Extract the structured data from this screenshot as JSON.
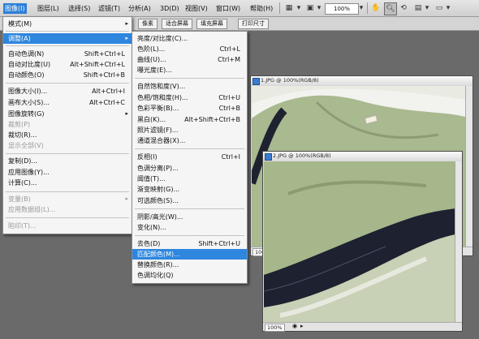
{
  "menubar": {
    "items": [
      "图像(I)",
      "图层(L)",
      "选择(S)",
      "滤镜(T)",
      "分析(A)",
      "3D(D)",
      "视图(V)",
      "窗口(W)",
      "帮助(H)"
    ],
    "zoom": "100%"
  },
  "options_bar": {
    "buttons": [
      "像素",
      "适合屏幕",
      "填充屏幕",
      "打印尺寸"
    ]
  },
  "image_menu": {
    "items": [
      {
        "label": "模式(M)",
        "shortcut": ""
      },
      {
        "label": "调整(A)",
        "shortcut": ""
      },
      {
        "label": "自动色调(N)",
        "shortcut": "Shift+Ctrl+L"
      },
      {
        "label": "自动对比度(U)",
        "shortcut": "Alt+Shift+Ctrl+L"
      },
      {
        "label": "自动颜色(O)",
        "shortcut": "Shift+Ctrl+B"
      },
      {
        "label": "图像大小(I)...",
        "shortcut": "Alt+Ctrl+I"
      },
      {
        "label": "画布大小(S)...",
        "shortcut": "Alt+Ctrl+C"
      },
      {
        "label": "图像旋转(G)",
        "shortcut": ""
      },
      {
        "label": "裁剪(P)",
        "shortcut": ""
      },
      {
        "label": "裁切(R)...",
        "shortcut": ""
      },
      {
        "label": "显示全部(V)",
        "shortcut": ""
      },
      {
        "label": "复制(D)...",
        "shortcut": ""
      },
      {
        "label": "应用图像(Y)...",
        "shortcut": ""
      },
      {
        "label": "计算(C)...",
        "shortcut": ""
      },
      {
        "label": "变量(B)",
        "shortcut": ""
      },
      {
        "label": "应用数据组(L)...",
        "shortcut": ""
      },
      {
        "label": "陷印(T)...",
        "shortcut": ""
      }
    ]
  },
  "adjust_menu": {
    "items": [
      {
        "label": "亮度/对比度(C)...",
        "shortcut": ""
      },
      {
        "label": "色阶(L)...",
        "shortcut": "Ctrl+L"
      },
      {
        "label": "曲线(U)...",
        "shortcut": "Ctrl+M"
      },
      {
        "label": "曝光度(E)...",
        "shortcut": ""
      },
      {
        "label": "自然饱和度(V)...",
        "shortcut": ""
      },
      {
        "label": "色相/饱和度(H)...",
        "shortcut": "Ctrl+U"
      },
      {
        "label": "色彩平衡(B)...",
        "shortcut": "Ctrl+B"
      },
      {
        "label": "黑白(K)...",
        "shortcut": "Alt+Shift+Ctrl+B"
      },
      {
        "label": "照片滤镜(F)...",
        "shortcut": ""
      },
      {
        "label": "通道混合器(X)...",
        "shortcut": ""
      },
      {
        "label": "反相(I)",
        "shortcut": "Ctrl+I"
      },
      {
        "label": "色调分离(P)...",
        "shortcut": ""
      },
      {
        "label": "阈值(T)...",
        "shortcut": ""
      },
      {
        "label": "渐变映射(G)...",
        "shortcut": ""
      },
      {
        "label": "可选颜色(S)...",
        "shortcut": ""
      },
      {
        "label": "阴影/高光(W)...",
        "shortcut": ""
      },
      {
        "label": "变化(N)...",
        "shortcut": ""
      },
      {
        "label": "去色(D)",
        "shortcut": "Shift+Ctrl+U"
      },
      {
        "label": "匹配颜色(M)...",
        "shortcut": ""
      },
      {
        "label": "替换颜色(R)...",
        "shortcut": ""
      },
      {
        "label": "色调均化(Q)",
        "shortcut": ""
      }
    ]
  },
  "doc1": {
    "title": "1.JPG @ 100%(RGB/8)",
    "zoom": "100%"
  },
  "doc2": {
    "title": "2.JPG @ 100%(RGB/8)",
    "zoom": "100%"
  },
  "colors": {
    "menu_highlight": "#2e86de",
    "garment": "#a7b78c",
    "trim": "#1f2330"
  }
}
